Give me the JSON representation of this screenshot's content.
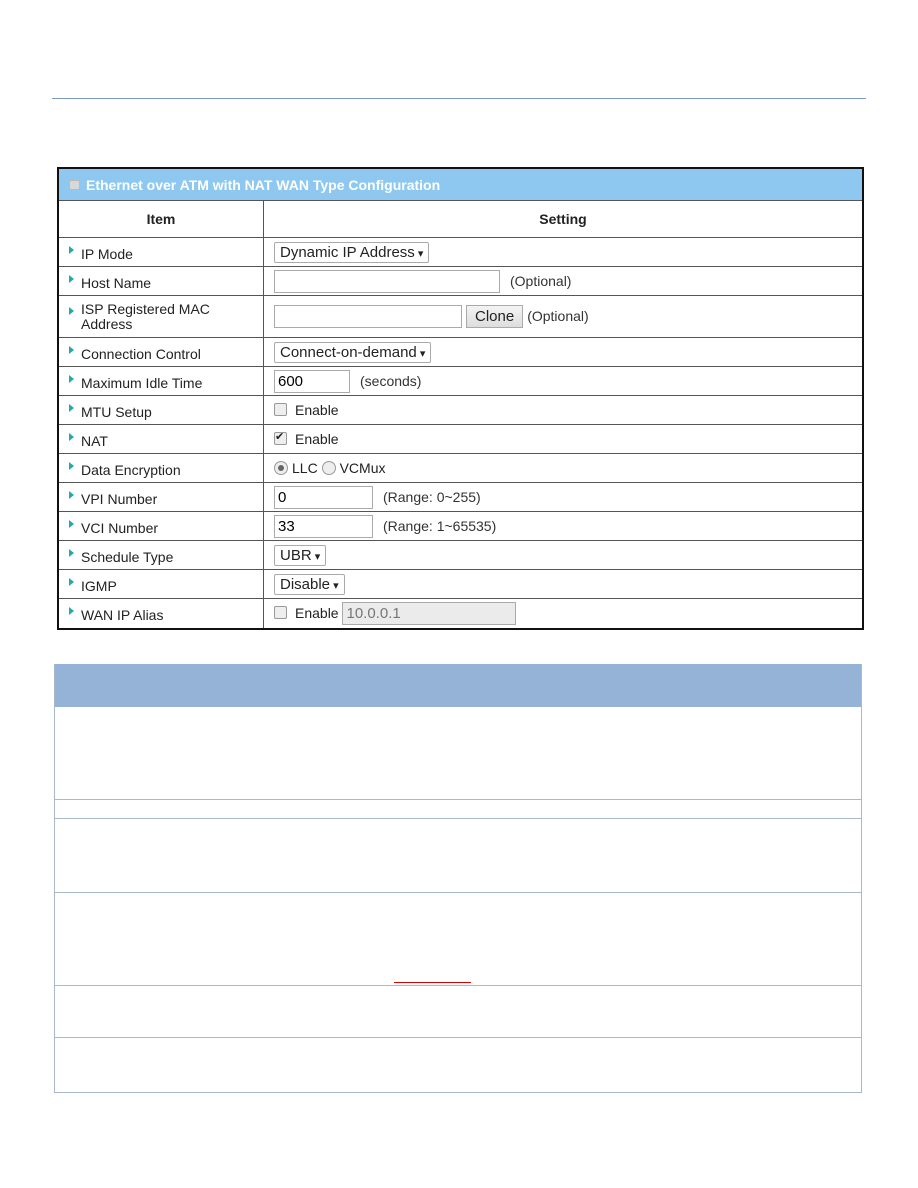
{
  "panel": {
    "title": "Ethernet over ATM with NAT WAN Type Configuration",
    "col_item": "Item",
    "col_setting": "Setting"
  },
  "rows": [
    {
      "label": "IP Mode",
      "select": "Dynamic IP Address"
    },
    {
      "label": "Host Name",
      "value": "",
      "note": "(Optional)"
    },
    {
      "label": "ISP Registered MAC Address",
      "value": "",
      "button": "Clone",
      "note": "(Optional)"
    },
    {
      "label": "Connection Control",
      "select": "Connect-on-demand"
    },
    {
      "label": "Maximum Idle Time",
      "value": "600",
      "note": "(seconds)"
    },
    {
      "label": "MTU Setup",
      "checkbox": "Enable",
      "checked": false
    },
    {
      "label": "NAT",
      "checkbox": "Enable",
      "checked": true
    },
    {
      "label": "Data Encryption",
      "options": [
        "LLC",
        "VCMux"
      ],
      "selected": "LLC"
    },
    {
      "label": "VPI Number",
      "value": "0",
      "note": "(Range: 0~255)"
    },
    {
      "label": "VCI Number",
      "value": "33",
      "note": "(Range: 1~65535)"
    },
    {
      "label": "Schedule Type",
      "select": "UBR"
    },
    {
      "label": "IGMP",
      "select": "Disable"
    },
    {
      "label": "WAN IP Alias",
      "checkbox": "Enable",
      "checked": false,
      "value": "10.0.0.1"
    }
  ],
  "colors": {
    "panel_header": "#8ec8f0",
    "desc_header": "#95b3d7",
    "arrow": "#22aaaa"
  }
}
